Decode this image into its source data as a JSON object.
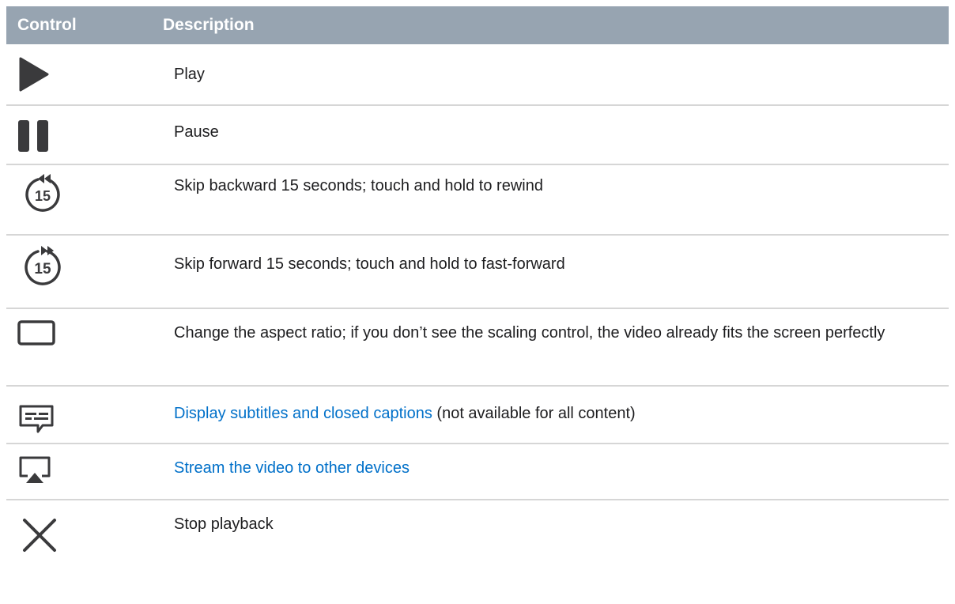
{
  "header": {
    "control": "Control",
    "description": "Description"
  },
  "rows": [
    {
      "icon": "play-icon",
      "desc": "Play"
    },
    {
      "icon": "pause-icon",
      "desc": "Pause"
    },
    {
      "icon": "skip-back-15-icon",
      "icon_text": "15",
      "desc": "Skip backward 15 seconds; touch and hold to rewind"
    },
    {
      "icon": "skip-forward-15-icon",
      "icon_text": "15",
      "desc": "Skip forward 15 seconds; touch and hold to fast-forward"
    },
    {
      "icon": "aspect-ratio-icon",
      "desc": "Change the aspect ratio; if you don’t see the scaling control, the video already fits the screen perfectly"
    },
    {
      "icon": "subtitles-icon",
      "link": "Display subtitles and closed captions",
      "desc_rest": " (not available for all content)"
    },
    {
      "icon": "airplay-icon",
      "link": "Stream the video to other devices"
    },
    {
      "icon": "close-icon",
      "desc": "Stop playback"
    }
  ],
  "colors": {
    "header_bg": "#97a4b1",
    "icon": "#3a3a3c",
    "link": "#0070c9",
    "divider": "#d6d6d6"
  }
}
